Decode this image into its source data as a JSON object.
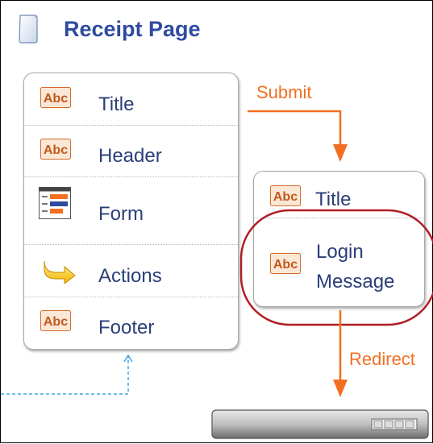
{
  "header": {
    "title": "Receipt Page"
  },
  "left_panel": {
    "items": [
      {
        "label": "Title",
        "icon": "abc-icon"
      },
      {
        "label": "Header",
        "icon": "abc-icon"
      },
      {
        "label": "Form",
        "icon": "form-icon"
      },
      {
        "label": "Actions",
        "icon": "arrow-icon"
      },
      {
        "label": "Footer",
        "icon": "abc-icon"
      }
    ]
  },
  "right_panel": {
    "items": [
      {
        "label": "Title",
        "icon": "abc-icon"
      },
      {
        "label_line1": "Login",
        "label_line2": "Message",
        "icon": "abc-icon"
      }
    ]
  },
  "edges": {
    "submit": "Submit",
    "redirect": "Redirect"
  },
  "colors": {
    "title_blue": "#2f4ba0",
    "label_blue": "#2a3e78",
    "arrow_orange": "#f26f21",
    "highlight_red": "#b01e23",
    "dashed_blue": "#3fa9e0"
  }
}
